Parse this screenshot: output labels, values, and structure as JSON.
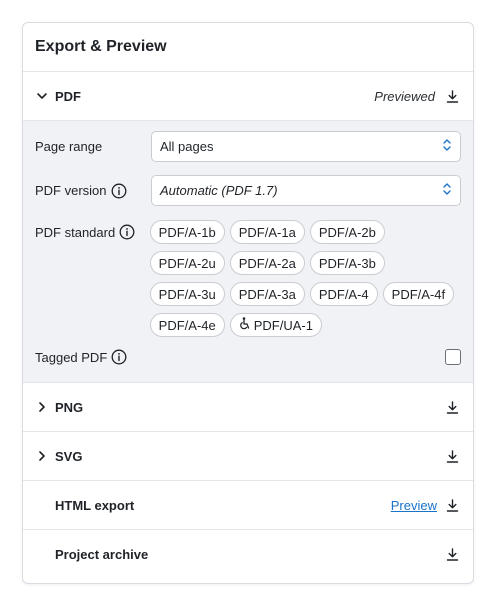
{
  "panel": {
    "title": "Export & Preview"
  },
  "pdf": {
    "label": "PDF",
    "status": "Previewed",
    "page_range": {
      "label": "Page range",
      "value": "All pages"
    },
    "pdf_version": {
      "label": "PDF version",
      "value": "Automatic (PDF 1.7)"
    },
    "pdf_standard": {
      "label": "PDF standard",
      "options": [
        "PDF/A-1b",
        "PDF/A-1a",
        "PDF/A-2b",
        "PDF/A-2u",
        "PDF/A-2a",
        "PDF/A-3b",
        "PDF/A-3u",
        "PDF/A-3a",
        "PDF/A-4",
        "PDF/A-4f",
        "PDF/A-4e",
        "PDF/UA-1"
      ]
    },
    "tagged_pdf": {
      "label": "Tagged PDF",
      "checked": false
    }
  },
  "png": {
    "label": "PNG"
  },
  "svg": {
    "label": "SVG"
  },
  "html_export": {
    "label": "HTML export",
    "preview_label": "Preview"
  },
  "project_archive": {
    "label": "Project archive"
  }
}
